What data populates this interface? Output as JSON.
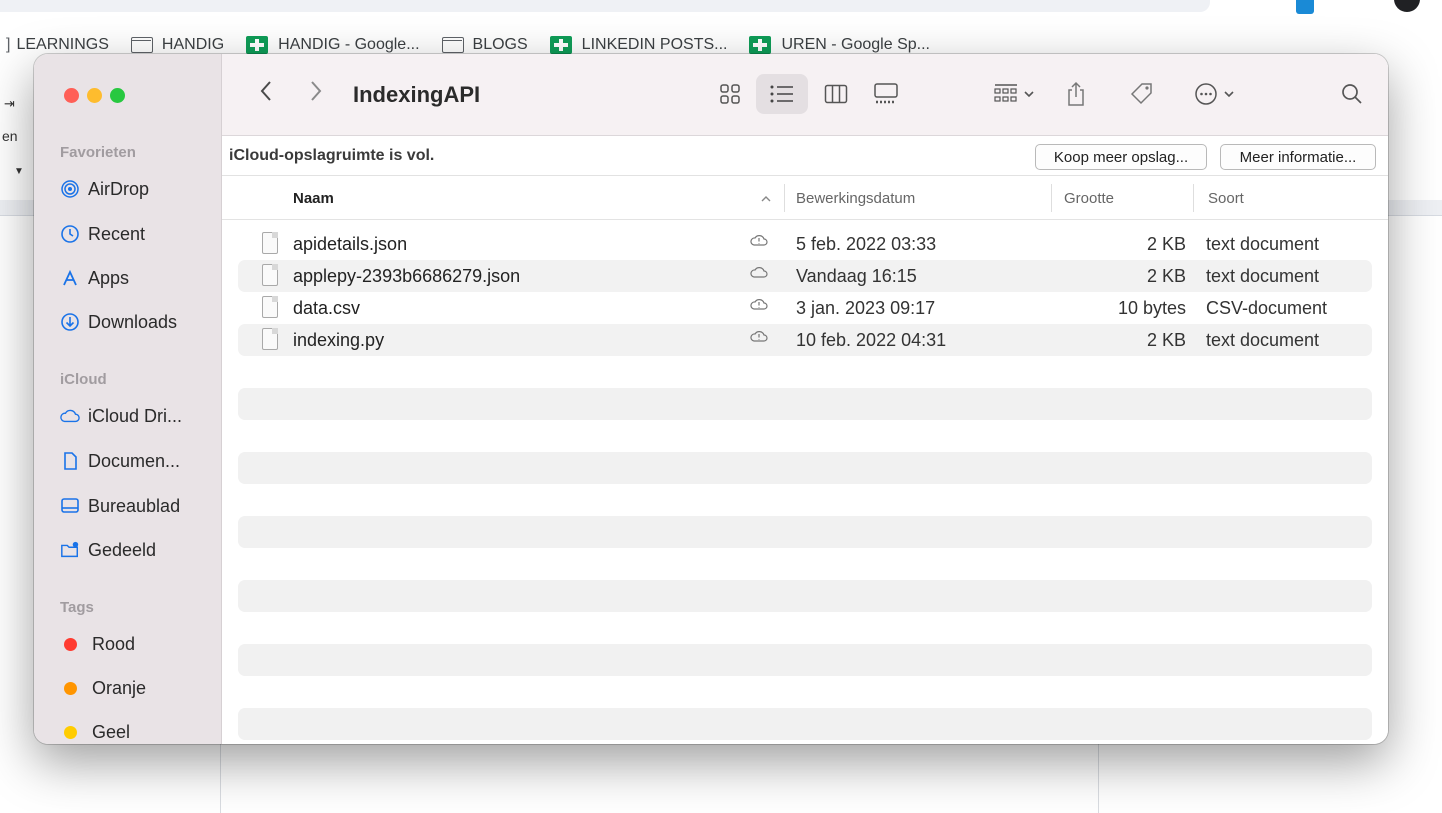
{
  "browser": {
    "bookmarks": [
      {
        "type": "folder",
        "label": "LEARNINGS"
      },
      {
        "type": "folder",
        "label": "HANDIG"
      },
      {
        "type": "sheet",
        "label": "HANDIG - Google..."
      },
      {
        "type": "folder",
        "label": "BLOGS"
      },
      {
        "type": "sheet",
        "label": "LINKEDIN POSTS..."
      },
      {
        "type": "sheet",
        "label": "UREN - Google Sp..."
      }
    ],
    "left_strip_text": "en"
  },
  "finder": {
    "title": "IndexingAPI",
    "sidebar": {
      "favorites_header": "Favorieten",
      "favorites": [
        {
          "label": "AirDrop",
          "icon": "airdrop-icon"
        },
        {
          "label": "Recent",
          "icon": "clock-icon"
        },
        {
          "label": "Apps",
          "icon": "apps-icon"
        },
        {
          "label": "Downloads",
          "icon": "download-icon"
        }
      ],
      "icloud_header": "iCloud",
      "icloud": [
        {
          "label": "iCloud Dri...",
          "icon": "cloud-icon"
        },
        {
          "label": "Documen...",
          "icon": "document-icon"
        },
        {
          "label": "Bureaublad",
          "icon": "desktop-icon"
        },
        {
          "label": "Gedeeld",
          "icon": "shared-folder-icon"
        }
      ],
      "tags_header": "Tags",
      "tags": [
        {
          "label": "Rood",
          "color": "#ff3b30"
        },
        {
          "label": "Oranje",
          "color": "#ff9500"
        },
        {
          "label": "Geel",
          "color": "#ffcc00"
        }
      ]
    },
    "banner": {
      "text": "iCloud-opslagruimte is vol.",
      "buy_label": "Koop meer opslag...",
      "info_label": "Meer informatie..."
    },
    "columns": {
      "name": "Naam",
      "date": "Bewerkingsdatum",
      "size": "Grootte",
      "kind": "Soort"
    },
    "files": [
      {
        "name": "apidetails.json",
        "date": "5 feb. 2022 03:33",
        "size": "2 KB",
        "kind": "text document",
        "cloud": "cloud-alert-icon"
      },
      {
        "name": "applepy-2393b6686279.json",
        "date": "Vandaag 16:15",
        "size": "2 KB",
        "kind": "text document",
        "cloud": "cloud-icon"
      },
      {
        "name": "data.csv",
        "date": "3 jan. 2023 09:17",
        "size": "10 bytes",
        "kind": "CSV-document",
        "cloud": "cloud-alert-icon"
      },
      {
        "name": "indexing.py",
        "date": "10 feb. 2022 04:31",
        "size": "2 KB",
        "kind": "text document",
        "cloud": "cloud-alert-icon"
      }
    ],
    "colors": {
      "close": "#ff5f57",
      "minimize": "#febc2e",
      "zoom": "#28c840",
      "sidebar_bg": "#e9e3e6",
      "accent": "#1a73e8"
    }
  }
}
